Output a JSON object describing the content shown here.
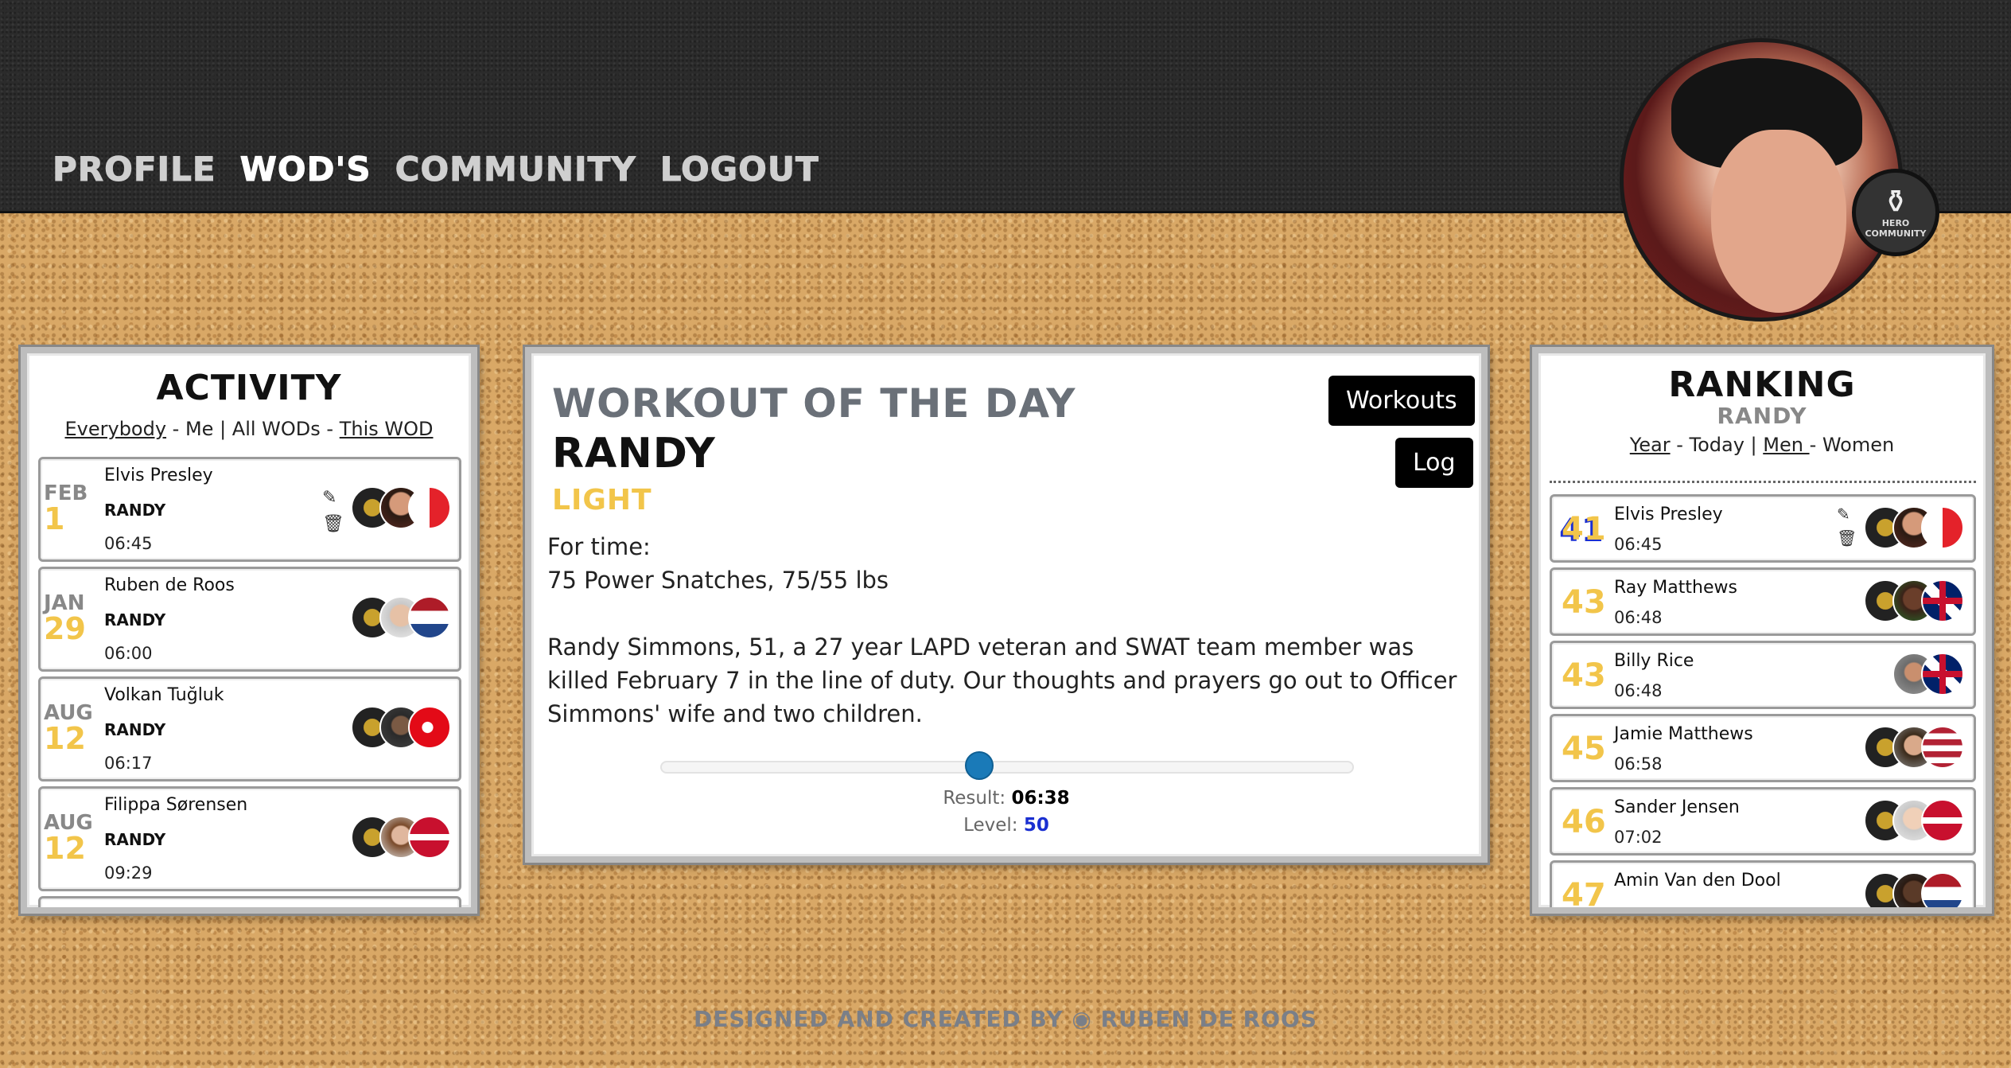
{
  "nav": {
    "items": [
      {
        "label": "PROFILE",
        "active": false
      },
      {
        "label": "WOD'S",
        "active": true
      },
      {
        "label": "COMMUNITY",
        "active": false
      },
      {
        "label": "LOGOUT",
        "active": false
      }
    ]
  },
  "community_badge": {
    "line1": "HERO",
    "line2": "COMMUNITY"
  },
  "activity": {
    "title": "ACTIVITY",
    "filters": {
      "everybody": "Everybody",
      "sep1": " - ",
      "me": "Me",
      "sep2": " | ",
      "all_wods": "All WODs",
      "sep3": " - ",
      "this_wod": "This WOD"
    },
    "items": [
      {
        "month": "FEB",
        "day": "1",
        "name": "Elvis Presley",
        "wod": "RANDY",
        "time": "06:45",
        "editable": true,
        "flag": "fr"
      },
      {
        "month": "JAN",
        "day": "29",
        "name": "Ruben de Roos",
        "wod": "RANDY",
        "time": "06:00",
        "editable": false,
        "flag": "nl"
      },
      {
        "month": "AUG",
        "day": "12",
        "name": "Volkan Tuğluk",
        "wod": "RANDY",
        "time": "06:17",
        "editable": false,
        "flag": "tr"
      },
      {
        "month": "AUG",
        "day": "12",
        "name": "Filippa Sørensen",
        "wod": "RANDY",
        "time": "09:29",
        "editable": false,
        "flag": "dk"
      }
    ]
  },
  "workout": {
    "heading": "WORKOUT OF THE DAY",
    "name": "RANDY",
    "level_label": "LIGHT",
    "workouts_button": "Workouts",
    "log_button": "Log",
    "line1": "For time:",
    "line2": "75 Power Snatches, 75/55 lbs",
    "story": "Randy Simmons, 51, a 27 year LAPD veteran and SWAT team member was killed February 7 in the line of duty. Our thoughts and prayers go out to Officer Simmons' wife and two children.",
    "result_label": "Result:",
    "result_value": "06:38",
    "level_label_text": "Level:",
    "level_value": "50",
    "slider_fraction": 0.46
  },
  "ranking": {
    "title": "RANKING",
    "subtitle": "RANDY",
    "filters": {
      "year": "Year",
      "sep1": " - ",
      "today": "Today",
      "sep2": " | ",
      "men": "Men ",
      "sep3": "- ",
      "women": "Women"
    },
    "items": [
      {
        "pos": "41",
        "name": "Elvis Presley",
        "time": "06:45",
        "editable": true,
        "flag": "fr"
      },
      {
        "pos": "43",
        "name": "Ray Matthews",
        "time": "06:48",
        "editable": false,
        "flag": "gb"
      },
      {
        "pos": "43",
        "name": "Billy Rice",
        "time": "06:48",
        "editable": false,
        "flag": "gb"
      },
      {
        "pos": "45",
        "name": "Jamie Matthews",
        "time": "06:58",
        "editable": false,
        "flag": "us"
      },
      {
        "pos": "46",
        "name": "Sander Jensen",
        "time": "07:02",
        "editable": false,
        "flag": "dk"
      },
      {
        "pos": "47",
        "name": "Amin Van den Dool",
        "time": "",
        "editable": false,
        "flag": "nl"
      }
    ]
  },
  "footer": {
    "text": "DESIGNED AND CREATED BY",
    "icon": "github-icon",
    "author": "RUBEN DE ROOS"
  },
  "colors": {
    "accent_yellow": "#f2c54a",
    "level_blue": "#1a2fd1",
    "slider_blue": "#1a7ab8"
  }
}
